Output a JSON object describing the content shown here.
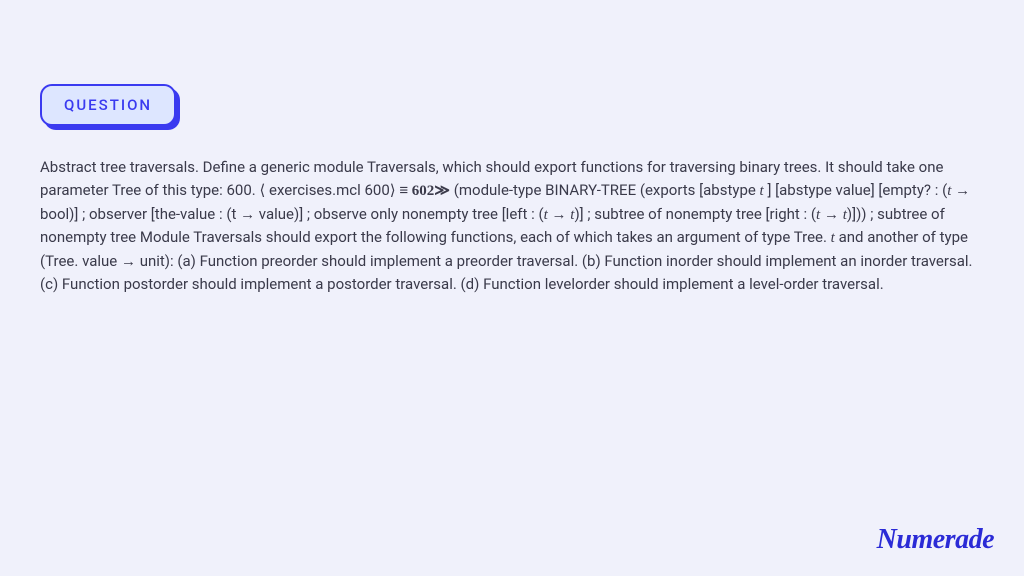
{
  "badge": {
    "label": "QUESTION"
  },
  "question": {
    "p1a": "Abstract tree traversals. Define a generic module Traversals, which should export functions for traversing binary trees. It should take one parameter Tree of this type: 600. ",
    "p1b": "⟨ exercises.mcl 600⟩ ≡ ",
    "p1c": "602≫",
    "p1d": " (module-type BINARY-TREE (exports [abstype ",
    "p1e": "t",
    "p1f": " ] [abstype value] [empty? :  (",
    "p1g": "t",
    "p1h": " → bool)] ; observer [the-value : (t → value)] ; observe only nonempty tree [left :  (",
    "p1i": "t → t",
    "p1j": ")]     ; subtree of nonempty tree [right :  (",
    "p1k": "t → t",
    "p1l": ")]))     ; subtree of nonempty tree Module Traversals should export the following functions, each of which takes an argument of type Tree. ",
    "p1m": "t",
    "p1n": " and another of type (Tree. value  → unit): (a) Function preorder should implement a preorder traversal. (b) Function inorder should implement an inorder traversal. (c) Function postorder should implement a postorder traversal. (d) Function levelorder should implement a level-order traversal."
  },
  "brand": {
    "name": "Numerade"
  }
}
